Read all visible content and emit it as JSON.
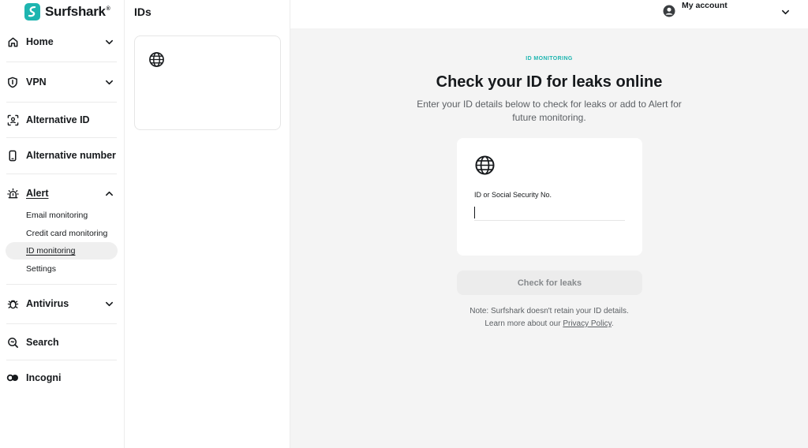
{
  "brand": {
    "name": "Surfshark",
    "reg": "®",
    "accent_color": "#1eb5b0"
  },
  "sidebar": {
    "items": [
      {
        "label": "Home",
        "icon": "home-icon",
        "chevron": "chevron-down-icon"
      },
      {
        "label": "VPN",
        "icon": "shield-icon",
        "chevron": "chevron-down-icon"
      },
      {
        "label": "Alternative ID",
        "icon": "face-scan-icon"
      },
      {
        "label": "Alternative number",
        "icon": "phone-icon"
      },
      {
        "label": "Alert",
        "icon": "alarm-icon",
        "chevron": "chevron-up-icon"
      },
      {
        "label": "Antivirus",
        "icon": "bug-icon",
        "chevron": "chevron-down-icon"
      },
      {
        "label": "Search",
        "icon": "search-icon"
      },
      {
        "label": "Incogni",
        "icon": "incogni-icon"
      }
    ],
    "alert_subitems": [
      {
        "label": "Email monitoring"
      },
      {
        "label": "Credit card monitoring"
      },
      {
        "label": "ID monitoring",
        "selected": true
      },
      {
        "label": "Settings"
      }
    ]
  },
  "ids_panel": {
    "title": "IDs",
    "card_icon": "globe-icon"
  },
  "header": {
    "account_label": "My account",
    "account_icon": "user-circle-icon"
  },
  "main": {
    "eyebrow": "ID MONITORING",
    "heading": "Check your ID for leaks online",
    "subtext": "Enter your ID details below to check for leaks or add to Alert for future monitoring.",
    "form": {
      "icon": "globe-icon",
      "field_label": "ID or Social Security No.",
      "field_value": "",
      "placeholder": ""
    },
    "button_label": "Check for leaks",
    "note_line1": "Note: Surfshark doesn't retain your ID details.",
    "note_line2_prefix": "Learn more about our ",
    "note_link": "Privacy Policy",
    "note_suffix": "."
  }
}
